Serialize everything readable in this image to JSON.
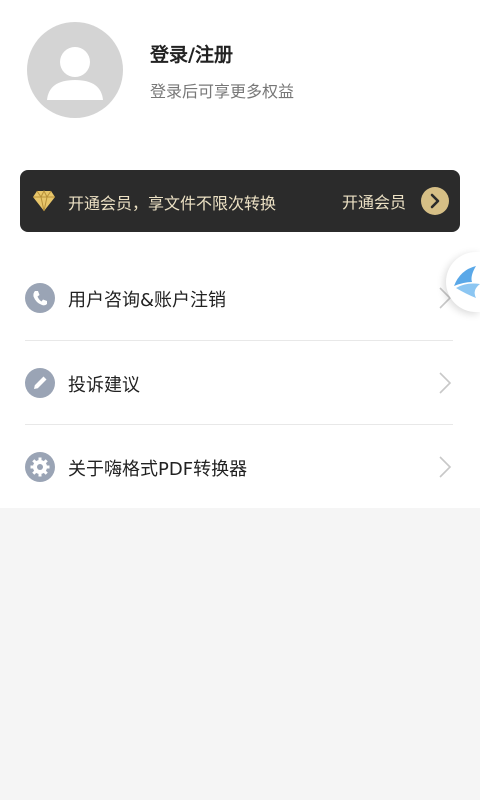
{
  "profile": {
    "login_title": "登录/注册",
    "login_subtitle": "登录后可享更多权益",
    "avatar_icon": "user-silhouette-icon"
  },
  "vip": {
    "promo_text": "开通会员，享文件不限次转换",
    "action_label": "开通会员",
    "diamond_icon": "diamond-icon",
    "arrow_icon": "chevron-right-icon",
    "banner_color": "#2b2b2b",
    "text_color": "#ece1c4",
    "accent_color": "#d6bf86"
  },
  "menu": {
    "items": [
      {
        "label": "用户咨询&账户注销",
        "icon": "phone-icon"
      },
      {
        "label": "投诉建议",
        "icon": "pencil-icon"
      },
      {
        "label": "关于嗨格式PDF转换器",
        "icon": "gear-icon"
      }
    ],
    "icon_color": "#9aa4b5"
  },
  "floating_widget": {
    "icon": "bird-icon",
    "color": "#5aa8e8"
  }
}
